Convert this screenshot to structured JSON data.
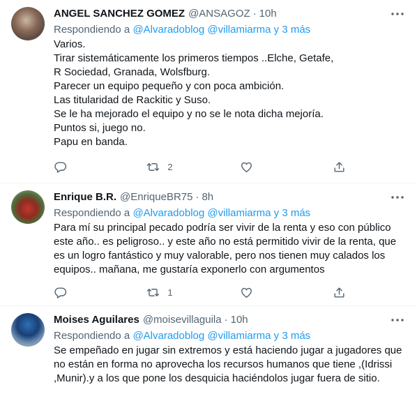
{
  "colors": {
    "link": "#1d9bf0",
    "secondary_text": "#536471",
    "primary_text": "#0f1419",
    "divider": "#eff3f4"
  },
  "tweets": [
    {
      "name": "ANGEL SANCHEZ GOMEZ",
      "handle": "@ANSAGOZ",
      "dot": "·",
      "time": "10h",
      "reply_prefix": "Respondiendo a",
      "mention1": "@Alvaradoblog",
      "mention2": "@villamiarma",
      "reply_suffix": "y 3 más",
      "lines": [
        "Varios.",
        "Tirar sistemáticamente los primeros tiempos ..Elche, Getafe,",
        "R Sociedad, Granada, Wolsfburg.",
        "Parecer un equipo pequeño y con poca ambición.",
        "Las titularidad de Rackitic y Suso.",
        "Se le ha mejorado el equipo y no se le nota dicha mejoría.",
        "Puntos si, juego no.",
        "Papu en banda."
      ],
      "reply_count": "",
      "retweet_count": "2",
      "like_count": ""
    },
    {
      "name": "Enrique B.R.",
      "handle": "@EnriqueBR75",
      "dot": "·",
      "time": "8h",
      "reply_prefix": "Respondiendo a",
      "mention1": "@Alvaradoblog",
      "mention2": "@villamiarma",
      "reply_suffix": "y 3 más",
      "lines": [
        "Para mí su principal pecado podría ser vivir de la renta y eso con público",
        "este año.. es peligroso.. y este año no está permitido vivir de la renta, que",
        "es un logro fantástico y muy valorable, pero nos tienen muy calados los",
        "equipos.. mañana, me gustaría exponerlo con argumentos"
      ],
      "reply_count": "",
      "retweet_count": "1",
      "like_count": ""
    },
    {
      "name": "Moises Aguilares",
      "handle": "@moisevillaguila",
      "dot": "·",
      "time": "10h",
      "reply_prefix": "Respondiendo a",
      "mention1": "@Alvaradoblog",
      "mention2": "@villamiarma",
      "reply_suffix": "y 3 más",
      "lines": [
        "Se empeñado en jugar sin extremos y está haciendo jugar a jugadores que",
        "no están en forma no aprovecha los recursos humanos que tiene ,(Idrissi",
        ",Munir).y a los que pone los desquicia haciéndolos jugar fuera de sitio."
      ]
    }
  ]
}
